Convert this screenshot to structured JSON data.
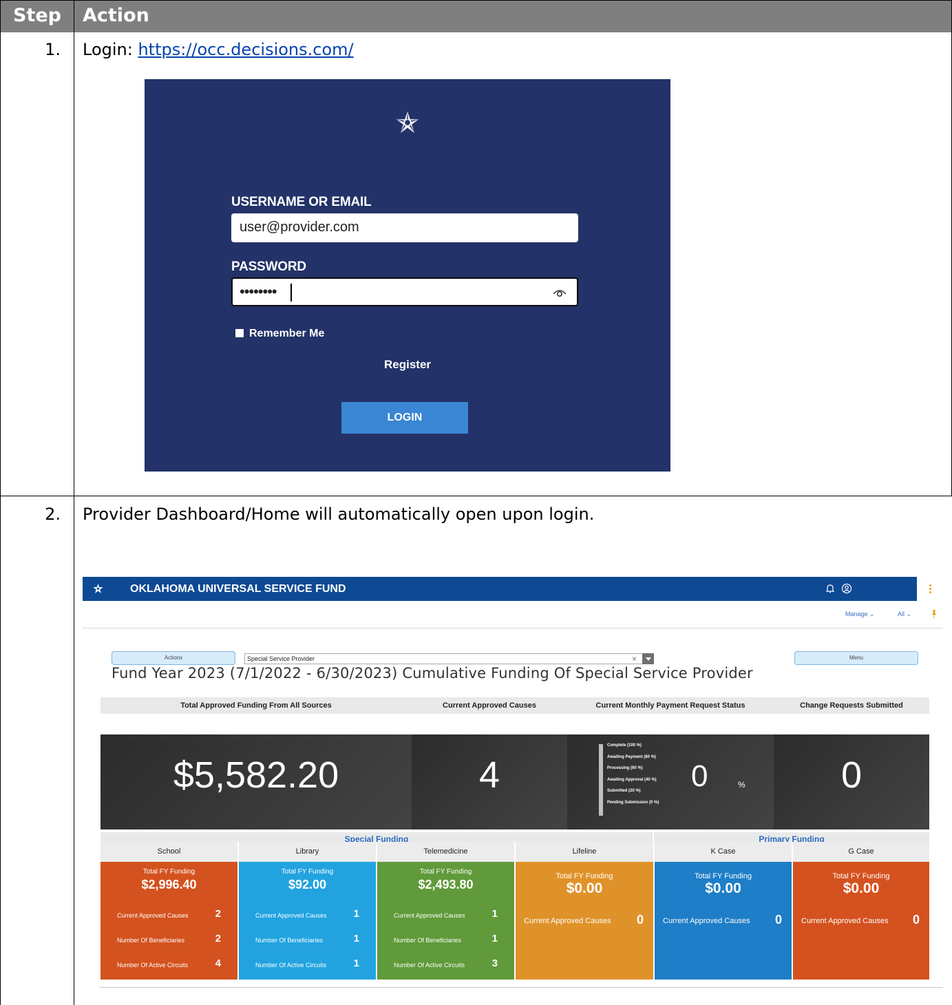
{
  "table": {
    "header_step": "Step",
    "header_action": "Action",
    "rows": [
      {
        "num": "1.",
        "prefix": "Login: ",
        "link": "https://occ.decisions.com/"
      },
      {
        "num": "2.",
        "text": "Provider Dashboard/Home will automatically open upon login."
      }
    ]
  },
  "login": {
    "username_label": "USERNAME OR EMAIL",
    "username_value": "user@provider.com",
    "password_label": "PASSWORD",
    "password_value": "••••••••",
    "remember_label": "Remember Me",
    "register_label": "Register",
    "login_button": "LOGIN"
  },
  "dashboard": {
    "app_title": "OKLAHOMA UNIVERSAL SERVICE FUND",
    "manage_label": "Manage ⌄",
    "all_label": "All ⌄",
    "actions_button": "Actions",
    "menu_button": "Menu",
    "provider_select": "Special Service Provider",
    "clear_symbol": "×",
    "fund_title": "Fund Year 2023 (7/1/2022 - 6/30/2023) Cumulative Funding Of Special Service Provider",
    "kpis": {
      "total_funding_label": "Total Approved Funding From All Sources",
      "total_funding_value": "$5,582.20",
      "approved_causes_label": "Current Approved Causes",
      "approved_causes_value": "4",
      "payment_status_label": "Current Monthly Payment Request Status",
      "payment_status_value": "0",
      "payment_status_unit": "%",
      "payment_status_levels": [
        "Complete (100 %)",
        "Awaiting Payment (80 %)",
        "Processing (60 %)",
        "Awaiting Approval (40 %)",
        "Submitted (20 %)",
        "Pending Submission (0 %)"
      ],
      "change_requests_label": "Change Requests Submitted",
      "change_requests_value": "0"
    },
    "groups": {
      "special": "Special Funding",
      "primary": "Primary Funding"
    },
    "categories": [
      {
        "name": "School",
        "funding_label": "Total FY Funding",
        "funding": "$2,996.40",
        "rows": [
          {
            "label": "Current Approved Causes",
            "value": "2"
          },
          {
            "label": "Number Of Beneficiaries",
            "value": "2"
          },
          {
            "label": "Number Of Active Circuits",
            "value": "4"
          }
        ]
      },
      {
        "name": "Library",
        "funding_label": "Total FY Funding",
        "funding": "$92.00",
        "rows": [
          {
            "label": "Current Approved Causes",
            "value": "1"
          },
          {
            "label": "Number Of Beneficiaries",
            "value": "1"
          },
          {
            "label": "Number Of Active Circuits",
            "value": "1"
          }
        ]
      },
      {
        "name": "Telemedicine",
        "funding_label": "Total FY Funding",
        "funding": "$2,493.80",
        "rows": [
          {
            "label": "Current Approved Causes",
            "value": "1"
          },
          {
            "label": "Number Of Beneficiaries",
            "value": "1"
          },
          {
            "label": "Number Of Active Circuits",
            "value": "3"
          }
        ]
      },
      {
        "name": "Lifeline",
        "funding_label": "Total FY Funding",
        "funding": "$0.00",
        "rows": [
          {
            "label": "Current Approved Causes",
            "value": "0"
          }
        ]
      },
      {
        "name": "K Case",
        "funding_label": "Total FY Funding",
        "funding": "$0.00",
        "rows": [
          {
            "label": "Current Approved Causes",
            "value": "0"
          }
        ]
      },
      {
        "name": "G Case",
        "funding_label": "Total FY Funding",
        "funding": "$0.00",
        "rows": [
          {
            "label": "Current Approved Causes",
            "value": "0"
          }
        ]
      }
    ],
    "tile_colors": [
      "#d4521f",
      "#22a3e0",
      "#609a3a",
      "#e0922a",
      "#1e7ec7",
      "#d4521f"
    ]
  }
}
